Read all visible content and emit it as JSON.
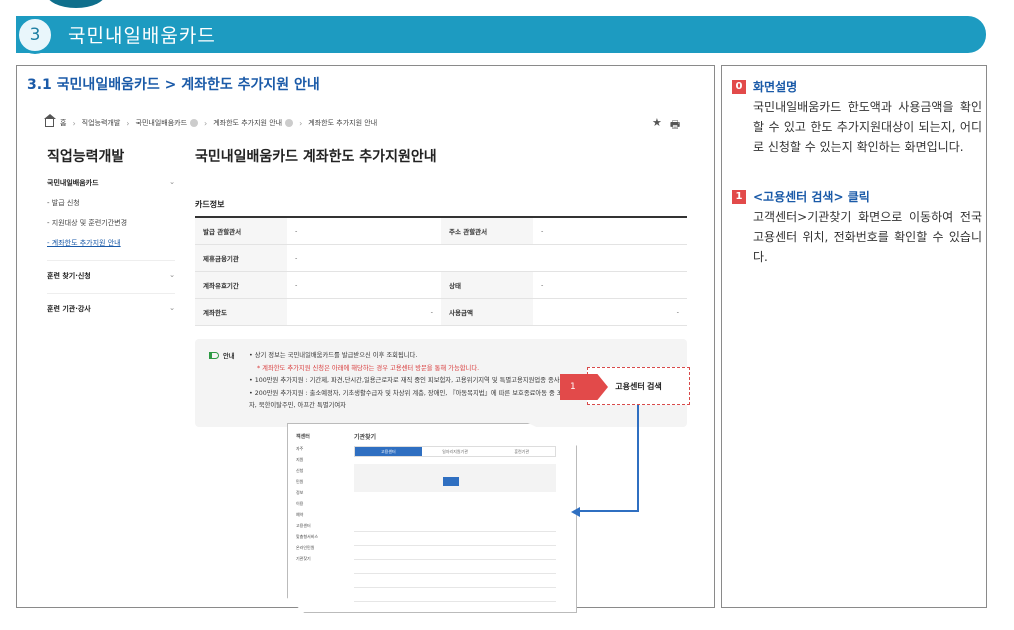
{
  "header": {
    "number": "3",
    "title": "국민내일배움카드"
  },
  "section": {
    "title": "3.1 국민내일배움카드 > 계좌한도 추가지원 안내"
  },
  "breadcrumb": [
    "홈",
    "직업능력개발",
    "국민내일배움카드",
    "계좌한도 추가지원 안내",
    "계좌한도 추가지원 안내"
  ],
  "icons": {
    "star": "★",
    "print": "🖶"
  },
  "sidebar": {
    "heading": "직업능력개발",
    "group1": "국민내일배움카드",
    "items": [
      "- 발급 신청",
      "- 지원대상 및 훈련기간변경",
      "- 계좌한도 추가지원 안내"
    ],
    "group2": "훈련 찾기·신청",
    "group3": "훈련 기관·강사",
    "chevron": "⌄"
  },
  "main": {
    "heading": "국민내일배움카드 계좌한도 추가지원안내",
    "card_title": "카드정보",
    "rows": [
      {
        "label1": "발급 관할관서",
        "value1": "-",
        "label2": "주소 관할관서",
        "value2": "-"
      },
      {
        "label1": "제휴금융기관",
        "value1": "-",
        "label2": "",
        "value2": ""
      },
      {
        "label1": "계좌유효기간",
        "value1": "-",
        "label2": "상태",
        "value2": "-"
      },
      {
        "label1": "계좌한도",
        "value1": "-",
        "label2": "사용금액",
        "value2": "-"
      }
    ],
    "notice": {
      "label": "안내",
      "line1": "• 상기 정보는 국민내일배움카드를 발급받으신 이후 조회됩니다.",
      "line2": "* 계좌한도 추가지원 신청은 아래에 해당하는 경우 고용센터 방문을 통해 가능합니다.",
      "line3": "• 100만원 추가지원 : 기간제, 파견,단시간,일용근로자로 재직 중인 피보험자, 고용위기지역 및 특별고용지원업종 종사자",
      "line4": "• 200만원 추가지원 : 출소예정자, 기초생활수급자 및 차상위 계층, 장애인, 『아동복지법』에 따른 보호종료아동 중 34세 이하자(자립준비청년), 한부모가족 해당자, 북한이탈주민, 아프간 특별기여자"
    },
    "search_button": "고용센터 검색",
    "step_tag": "1"
  },
  "thumbnail": {
    "side_title": "객센터",
    "title": "기관찾기",
    "tabs": [
      "고용센터",
      "일자리지원기관",
      "훈련기관"
    ],
    "side_items": [
      "자주",
      "지원",
      "신청",
      "민원",
      "정보",
      "이용",
      "예약",
      "고용센터",
      "맞춤형서비스",
      "온라인민원",
      "기관찾기"
    ]
  },
  "right": {
    "item0_badge": "0",
    "item0_title": "화면설명",
    "item0_body": "국민내일배움카드 한도액과 사용금액을 확인할 수 있고 한도 추가지원대상이 되는지, 어디로 신청할 수 있는지 확인하는 화면입니다.",
    "item1_badge": "1",
    "item1_title": "<고용센터 검색> 클릭",
    "item1_body": "고객센터>기관찾기 화면으로 이동하여 전국 고용센터 위치, 전화번호를 확인할 수 있습니다."
  }
}
